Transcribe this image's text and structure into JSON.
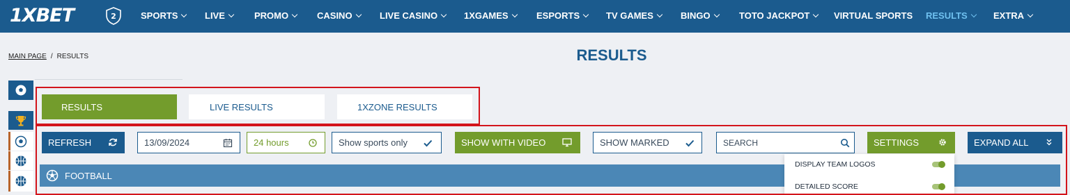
{
  "header": {
    "logo_text": "1XBET",
    "shield_number": "2",
    "nav_items": [
      {
        "label": "SPORTS",
        "dropdown": true
      },
      {
        "label": "LIVE",
        "dropdown": true
      },
      {
        "label": "PROMO",
        "dropdown": true
      },
      {
        "label": "CASINO",
        "dropdown": true
      },
      {
        "label": "LIVE CASINO",
        "dropdown": true
      },
      {
        "label": "1XGAMES",
        "dropdown": true
      },
      {
        "label": "ESPORTS",
        "dropdown": true
      },
      {
        "label": "TV GAMES",
        "dropdown": true
      },
      {
        "label": "BINGO",
        "dropdown": true
      },
      {
        "label": "TOTO JACKPOT",
        "dropdown": true
      },
      {
        "label": "VIRTUAL SPORTS",
        "dropdown": false
      },
      {
        "label": "RESULTS",
        "dropdown": true,
        "active": true
      },
      {
        "label": "EXTRA",
        "dropdown": true
      }
    ]
  },
  "breadcrumb": {
    "home": "MAIN PAGE",
    "separator": "/",
    "current": "RESULTS"
  },
  "page_title": "RESULTS",
  "sidebar": {
    "icons": [
      "football-icon",
      "trophy-icon",
      "football-icon",
      "basketball-icon",
      "basketball-icon"
    ]
  },
  "tabs": [
    {
      "label": "RESULTS",
      "active": true
    },
    {
      "label": "LIVE RESULTS",
      "active": false
    },
    {
      "label": "1XZONE RESULTS",
      "active": false
    }
  ],
  "filters": {
    "refresh_label": "REFRESH",
    "date_value": "13/09/2024",
    "period_value": "24 hours",
    "sports_filter_value": "Show sports only",
    "show_with_video_label": "SHOW WITH VIDEO",
    "show_marked_label": "SHOW MARKED",
    "search_placeholder": "SEARCH",
    "settings_label": "SETTINGS",
    "expand_all_label": "EXPAND ALL"
  },
  "settings_menu": {
    "items": [
      {
        "label": "DISPLAY TEAM LOGOS",
        "enabled": true
      },
      {
        "label": "DETAILED SCORE",
        "enabled": true
      }
    ]
  },
  "sport_section": {
    "label": "FOOTBALL"
  },
  "colors": {
    "brand_blue": "#1b5b8e",
    "accent_green": "#739c2c",
    "active_nav": "#6fc1f0",
    "section_bar": "#4b87b6",
    "annotation_red": "#d3141b"
  }
}
